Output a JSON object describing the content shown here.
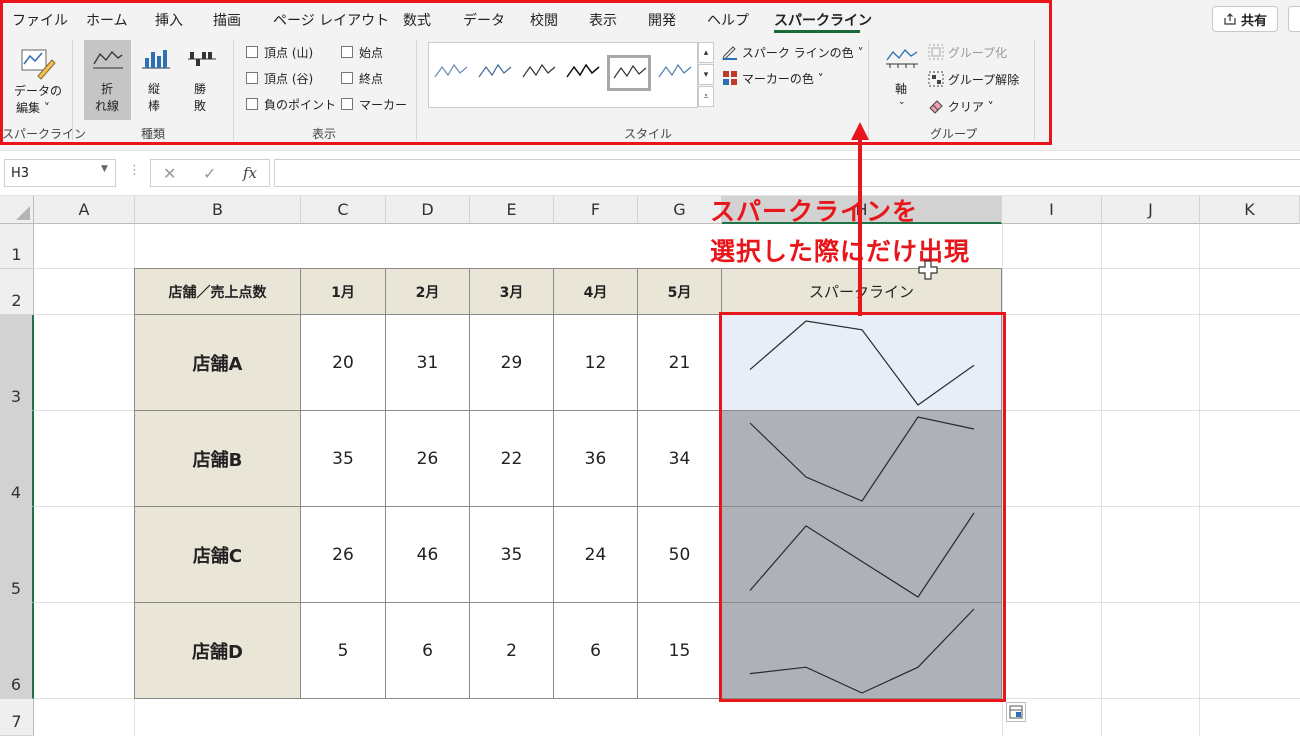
{
  "ribbon": {
    "tabs": [
      "ファイル",
      "ホーム",
      "挿入",
      "描画",
      "ページ レイアウト",
      "数式",
      "データ",
      "校閲",
      "表示",
      "開発",
      "ヘルプ",
      "スパークライン"
    ],
    "active_tab": "スパークライン",
    "share_label": "共有",
    "sparkline_group": {
      "edit_data": [
        "データの",
        "編集 ˅"
      ],
      "label": "スパークライン"
    },
    "type_group": {
      "line": [
        "折",
        "れ線"
      ],
      "column": [
        "縦",
        "棒"
      ],
      "winloss": [
        "勝",
        "敗"
      ],
      "label": "種類"
    },
    "show_group": {
      "high_point": "頂点 (山)",
      "low_point": "頂点 (谷)",
      "negative_points": "負のポイント",
      "first_point": "始点",
      "last_point": "終点",
      "markers": "マーカー",
      "label": "表示"
    },
    "style_group": {
      "sparkline_color": "スパーク ラインの色 ˅",
      "marker_color": "マーカーの色 ˅",
      "label": "スタイル"
    },
    "group_group": {
      "axis": "軸",
      "group": "グループ化",
      "ungroup": "グループ解除",
      "clear": "クリア ˅",
      "label": "グループ"
    }
  },
  "formula_bar": {
    "name_box": "H3",
    "cancel": "✕",
    "enter": "✓",
    "fx": "fx",
    "value": ""
  },
  "sheet": {
    "columns": [
      "A",
      "B",
      "C",
      "D",
      "E",
      "F",
      "G",
      "H",
      "I",
      "J",
      "K"
    ],
    "selected_column": "H",
    "rows": [
      "1",
      "2",
      "3",
      "4",
      "5",
      "6",
      "7"
    ],
    "table": {
      "header": [
        "店舗／売上点数",
        "1月",
        "2月",
        "3月",
        "4月",
        "5月",
        "スパークライン"
      ],
      "stores": [
        {
          "name": "店舗A",
          "values": [
            "20",
            "31",
            "29",
            "12",
            "21"
          ]
        },
        {
          "name": "店舗B",
          "values": [
            "35",
            "26",
            "22",
            "36",
            "34"
          ]
        },
        {
          "name": "店舗C",
          "values": [
            "26",
            "46",
            "35",
            "24",
            "50"
          ]
        },
        {
          "name": "店舗D",
          "values": [
            "5",
            "6",
            "2",
            "6",
            "15"
          ]
        }
      ]
    }
  },
  "annotation": {
    "line1": "スパークラインを",
    "line2": "選択した際にだけ出現",
    "color": "#e8161b"
  },
  "colors": {
    "highlight": "#e8161b",
    "header_fill": "#eae6d7",
    "selected_sparkline_fill": "#e8eef8",
    "group_sparkline_fill": "#aeb1b8",
    "excel_green": "#1f7346"
  }
}
